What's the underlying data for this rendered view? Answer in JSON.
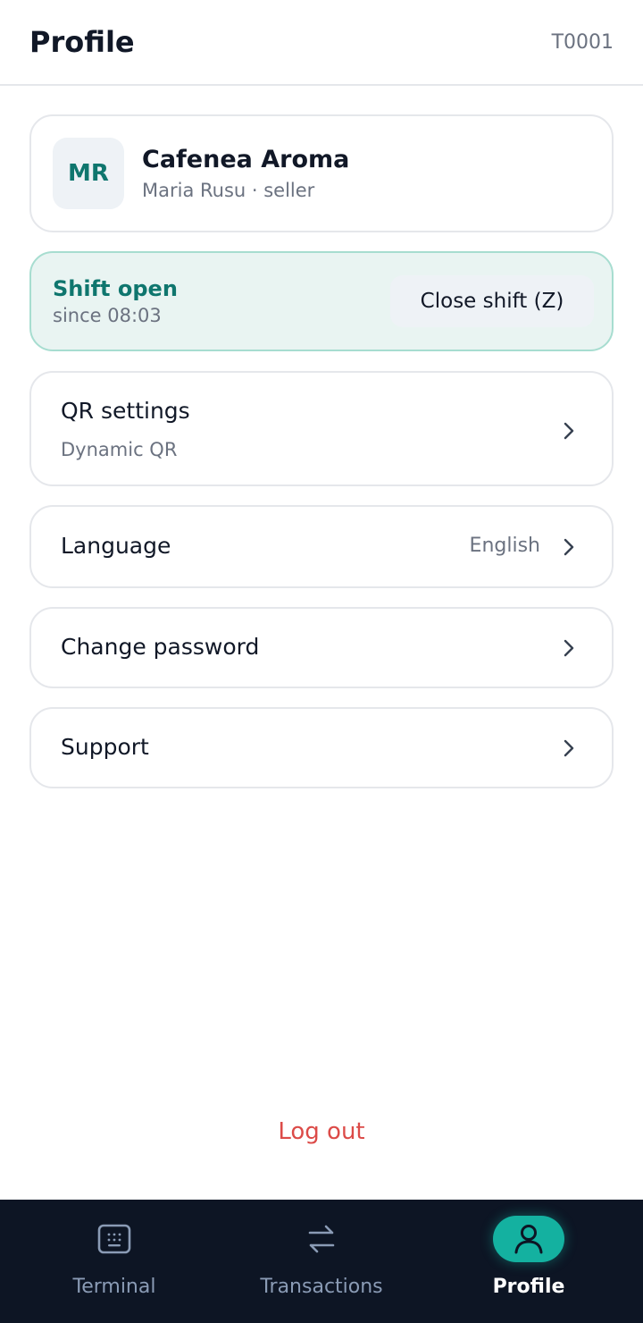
{
  "header": {
    "title": "Profile",
    "terminal_id": "T0001"
  },
  "merchant": {
    "initials": "MR",
    "name": "Cafenea Aroma",
    "subtitle": "Maria Rusu · seller"
  },
  "shift": {
    "status": "Shift open",
    "since": "since 08:03",
    "close_button": "Close shift (Z)"
  },
  "menu": {
    "qr": {
      "label": "QR settings",
      "sub": "Dynamic QR"
    },
    "language": {
      "label": "Language",
      "value": "English"
    },
    "password": {
      "label": "Change password"
    },
    "support": {
      "label": "Support"
    }
  },
  "logout_label": "Log out",
  "nav": {
    "items": [
      {
        "label": "Terminal",
        "icon": "keypad-icon"
      },
      {
        "label": "Transactions",
        "icon": "swap-arrows-icon"
      },
      {
        "label": "Profile",
        "icon": "user-icon",
        "active": true
      }
    ]
  },
  "colors": {
    "accent": "#0f766e",
    "nav_active": "#14b1a0",
    "nav_bg": "#0d1524",
    "danger": "#dc4b48",
    "shift_bg": "#e9f4f2"
  }
}
